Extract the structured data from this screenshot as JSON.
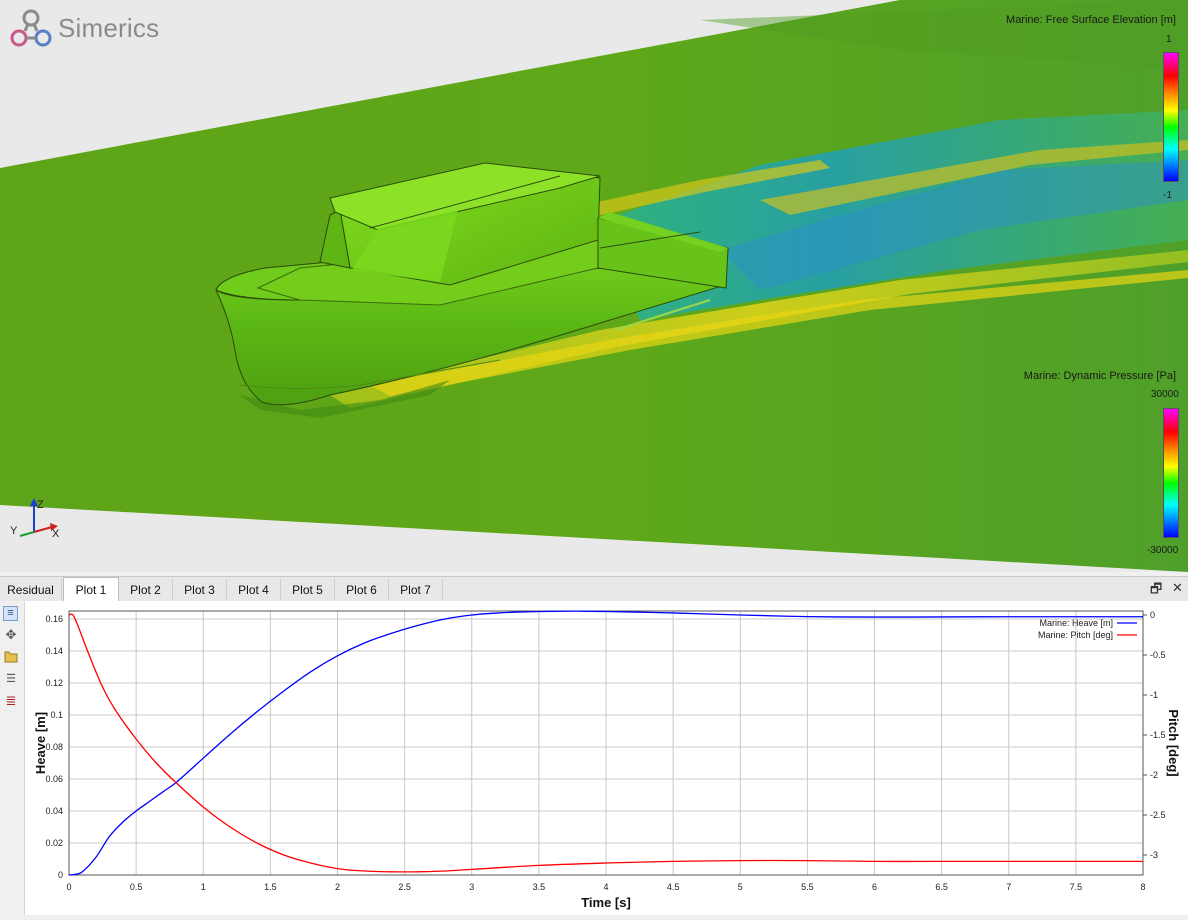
{
  "brand": {
    "name": "Simerics"
  },
  "viewport": {
    "legend_top": {
      "title": "Marine: Free Surface Elevation [m]",
      "max": "1",
      "min": "-1"
    },
    "legend_bottom": {
      "title": "Marine: Dynamic Pressure [Pa]",
      "max": "30000",
      "min": "-30000"
    },
    "triad": {
      "z": "Z",
      "y": "Y",
      "x": "X"
    }
  },
  "tabs": [
    "Residual",
    "Plot 1",
    "Plot 2",
    "Plot 3",
    "Plot 4",
    "Plot 5",
    "Plot 6",
    "Plot 7"
  ],
  "active_tab": "Plot 1",
  "window_buttons": {
    "restore": "🗗",
    "close": "✕"
  },
  "toolbar_icons": [
    "list-icon",
    "move-icon",
    "folder-icon",
    "series-list-icon",
    "lines-icon"
  ],
  "colors": {
    "heave": "#0000ff",
    "pitch": "#ff0000",
    "grid": "#c8c8c8"
  },
  "chart_data": {
    "type": "line",
    "xlabel": "Time [s]",
    "ylabel": "Heave [m]",
    "y2label": "Pitch [deg]",
    "xlim": [
      0,
      8
    ],
    "ylim": [
      0,
      0.165
    ],
    "y2lim": [
      -3.25,
      0.05
    ],
    "x_ticks": [
      "0",
      "0.5",
      "1",
      "1.5",
      "2",
      "2.5",
      "3",
      "3.5",
      "4",
      "4.5",
      "5",
      "5.5",
      "6",
      "6.5",
      "7",
      "7.5",
      "8"
    ],
    "y_ticks": [
      "0",
      "0.02",
      "0.04",
      "0.06",
      "0.08",
      "0.1",
      "0.12",
      "0.14",
      "0.16"
    ],
    "y2_ticks": [
      "0",
      "-0.5",
      "-1",
      "-1.5",
      "-2",
      "-2.5",
      "-3"
    ],
    "grid": true,
    "legend_position": "top-right",
    "series": [
      {
        "name": "Marine: Heave [m]",
        "axis": "left",
        "x": [
          0,
          0.05,
          0.1,
          0.2,
          0.3,
          0.4,
          0.5,
          0.6,
          0.7,
          0.8,
          1.0,
          1.2,
          1.4,
          1.6,
          1.8,
          2.0,
          2.2,
          2.4,
          2.6,
          2.8,
          3.0,
          3.2,
          3.4,
          3.6,
          3.8,
          4.0,
          4.5,
          5.0,
          5.5,
          6.0,
          6.5,
          7.0,
          7.5,
          8.0
        ],
        "values": [
          0,
          0.0005,
          0.002,
          0.011,
          0.024,
          0.033,
          0.04,
          0.046,
          0.052,
          0.058,
          0.073,
          0.088,
          0.102,
          0.115,
          0.127,
          0.137,
          0.145,
          0.151,
          0.156,
          0.16,
          0.1625,
          0.1638,
          0.1645,
          0.1648,
          0.1649,
          0.1647,
          0.1638,
          0.1625,
          0.1615,
          0.1612,
          0.1613,
          0.1614,
          0.1614,
          0.1614
        ]
      },
      {
        "name": "Marine: Pitch [deg]",
        "axis": "right",
        "x": [
          0,
          0.03,
          0.07,
          0.15,
          0.25,
          0.35,
          0.5,
          0.65,
          0.8,
          1.0,
          1.2,
          1.4,
          1.6,
          1.8,
          2.0,
          2.2,
          2.4,
          2.6,
          2.8,
          3.0,
          3.5,
          4.0,
          4.5,
          5.0,
          5.5,
          6.0,
          6.5,
          7.0,
          7.5,
          8.0
        ],
        "values": [
          0,
          0.0,
          -0.15,
          -0.5,
          -0.9,
          -1.2,
          -1.55,
          -1.85,
          -2.1,
          -2.4,
          -2.65,
          -2.85,
          -3.0,
          -3.1,
          -3.17,
          -3.2,
          -3.21,
          -3.21,
          -3.2,
          -3.18,
          -3.13,
          -3.1,
          -3.08,
          -3.07,
          -3.07,
          -3.08,
          -3.08,
          -3.08,
          -3.08,
          -3.08
        ]
      }
    ]
  }
}
